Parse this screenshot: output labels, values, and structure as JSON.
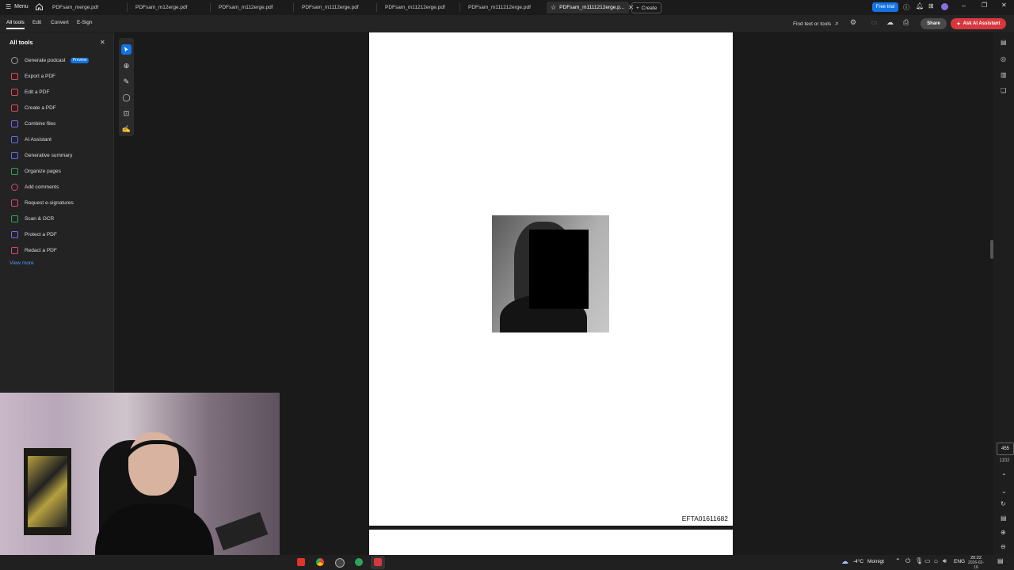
{
  "titlebar": {
    "menu_label": "Menu",
    "tabs": [
      {
        "label": "PDFsam_merge.pdf"
      },
      {
        "label": "PDFsam_m12erge.pdf"
      },
      {
        "label": "PDFsam_m112erge.pdf"
      },
      {
        "label": "PDFsam_m1112erge.pdf"
      },
      {
        "label": "PDFsam_m11212erge.pdf"
      },
      {
        "label": "PDFsam_m111212erge.pdf"
      },
      {
        "label": "PDFsam_m1111212erge.p..."
      }
    ],
    "create_label": "Create",
    "free_trial_label": "Free trial"
  },
  "menubar": {
    "items": [
      "All tools",
      "Edit",
      "Convert",
      "E-Sign"
    ],
    "find_label": "Find text or tools",
    "share_label": "Share",
    "ask_ai_label": "Ask AI Assistant"
  },
  "left_panel": {
    "title": "All tools",
    "items": [
      {
        "label": "Generate podcast",
        "badge": "Preview",
        "color": "#9aa0a6"
      },
      {
        "label": "Export a PDF",
        "color": "#e34850"
      },
      {
        "label": "Edit a PDF",
        "color": "#e34850"
      },
      {
        "label": "Create a PDF",
        "color": "#e34850"
      },
      {
        "label": "Combine files",
        "color": "#7b68ee"
      },
      {
        "label": "AI Assistant",
        "color": "#5b6ee8"
      },
      {
        "label": "Generative summary",
        "color": "#5b6ee8"
      },
      {
        "label": "Organize pages",
        "color": "#2fa35a"
      },
      {
        "label": "Add comments",
        "color": "#d9467a"
      },
      {
        "label": "Request e-signatures",
        "color": "#d9467a"
      },
      {
        "label": "Scan & OCR",
        "color": "#2fa35a"
      },
      {
        "label": "Protect a PDF",
        "color": "#7b68ee"
      },
      {
        "label": "Redact a PDF",
        "color": "#d9467a"
      }
    ],
    "view_more": "View more"
  },
  "document": {
    "footer_code": "EFTA01611682"
  },
  "page_indicator": {
    "current": "455",
    "total": "1102"
  },
  "taskbar": {
    "weather": "-4°C",
    "weather_label": "Molnigt",
    "lang": "ENG",
    "time": "20:22",
    "date": "2026-02-16"
  },
  "colors": {
    "accent_blue": "#1473e6",
    "ai_button": "#d7373f"
  }
}
